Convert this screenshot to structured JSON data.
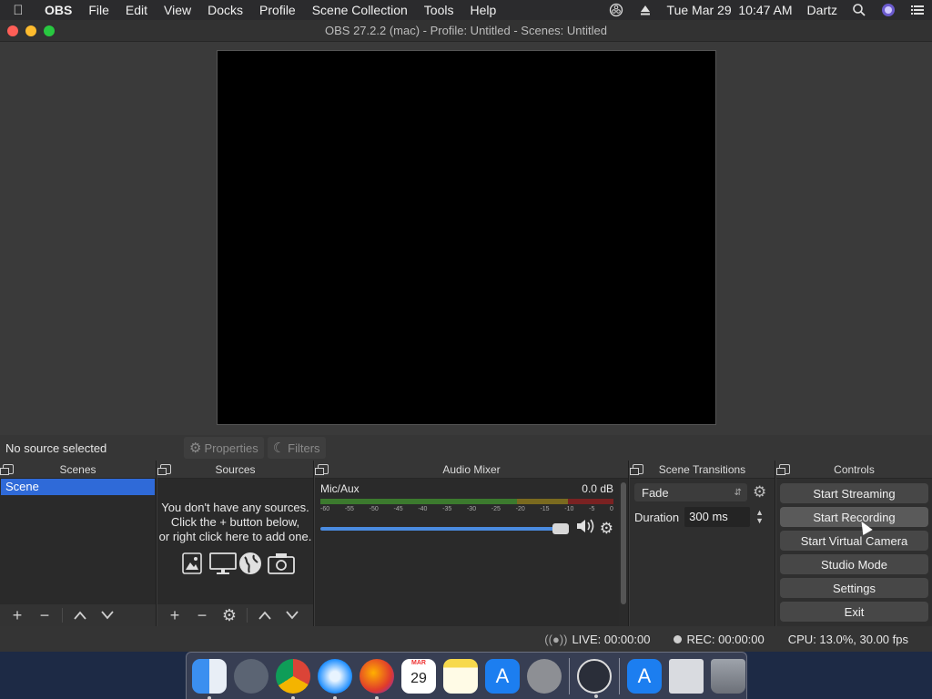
{
  "menubar": {
    "app_name": "OBS",
    "items": [
      "File",
      "Edit",
      "View",
      "Docks",
      "Profile",
      "Scene Collection",
      "Tools",
      "Help"
    ],
    "datetime": "Tue Mar 29  10:47 AM",
    "user": "Dartz"
  },
  "window": {
    "title": "OBS 27.2.2 (mac) - Profile: Untitled - Scenes: Untitled"
  },
  "source_toolbar": {
    "status": "No source selected",
    "properties_label": "Properties",
    "filters_label": "Filters"
  },
  "docks": {
    "scenes": {
      "title": "Scenes",
      "items": [
        "Scene"
      ]
    },
    "sources": {
      "title": "Sources",
      "empty_line1": "You don't have any sources.",
      "empty_line2": "Click the + button below,",
      "empty_line3": "or right click here to add one."
    },
    "audio_mixer": {
      "title": "Audio Mixer",
      "channel": "Mic/Aux",
      "level": "0.0 dB",
      "ticks": [
        "-60",
        "-55",
        "-50",
        "-45",
        "-40",
        "-35",
        "-30",
        "-25",
        "-20",
        "-15",
        "-10",
        "-5",
        "0"
      ],
      "volume_fraction": 1.0
    },
    "transitions": {
      "title": "Scene Transitions",
      "selected": "Fade",
      "duration_label": "Duration",
      "duration_value": "300 ms"
    },
    "controls": {
      "title": "Controls",
      "buttons": [
        "Start Streaming",
        "Start Recording",
        "Start Virtual Camera",
        "Studio Mode",
        "Settings",
        "Exit"
      ]
    }
  },
  "statusbar": {
    "live": "LIVE: 00:00:00",
    "rec": "REC: 00:00:00",
    "cpu": "CPU: 13.0%, 30.00 fps"
  },
  "dock_apps": [
    "finder-icon",
    "launchpad-icon",
    "chrome-icon",
    "safari-icon",
    "firefox-icon",
    "calendar-icon",
    "notes-icon",
    "app-store-icon",
    "system-preferences-icon",
    "obs-icon",
    "app-store-downloads-icon",
    "documents-icon",
    "trash-icon"
  ],
  "calendar": {
    "month": "MAR",
    "day": "29"
  },
  "colors": {
    "accent": "#2f6ad8",
    "window_bg": "#3c3c3c"
  }
}
